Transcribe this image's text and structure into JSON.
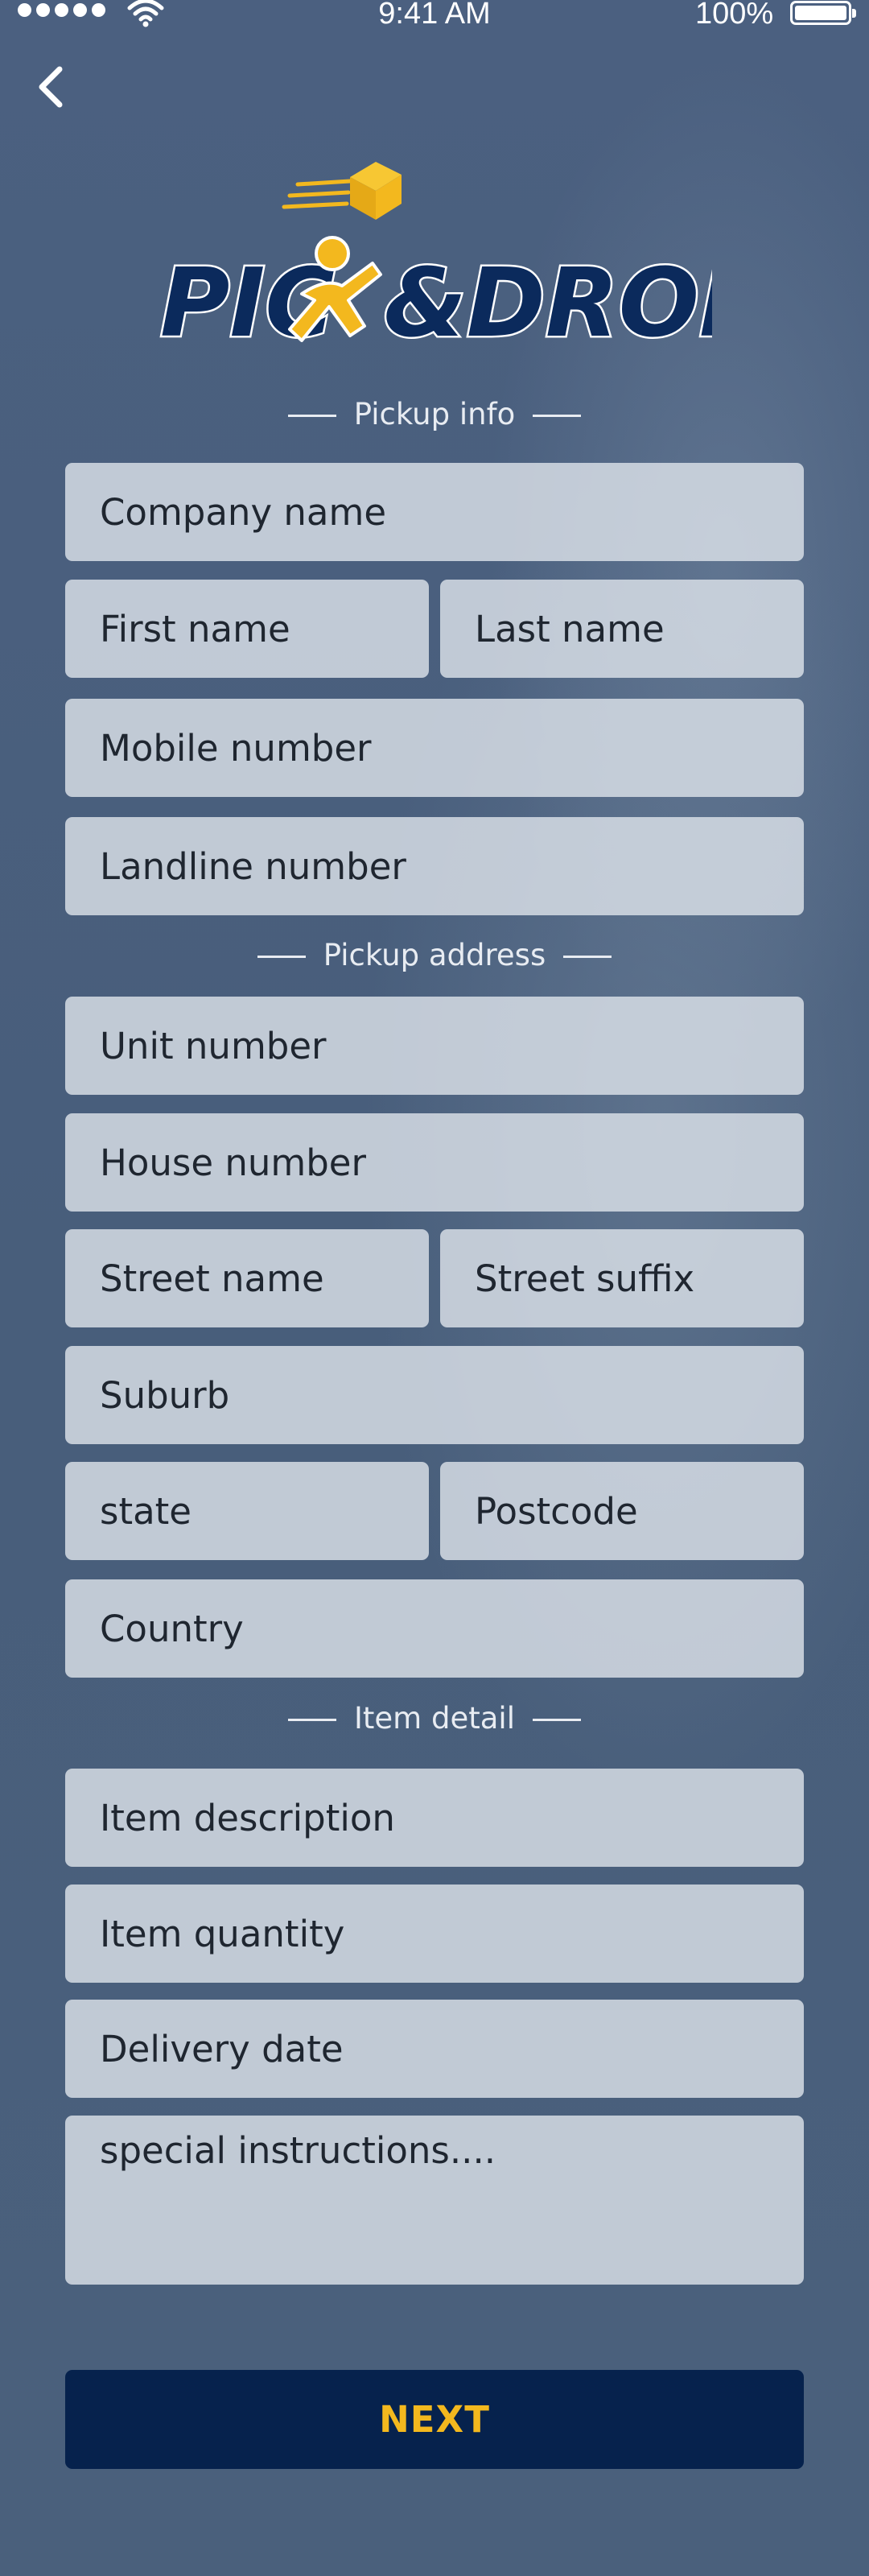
{
  "status_bar": {
    "time": "9:41 AM",
    "battery": "100%"
  },
  "logo": {
    "text_left": "PIC",
    "text_right": "&DROP",
    "brand_colors": {
      "navy": "#0b2a5c",
      "yellow": "#f3b81e",
      "white": "#ffffff"
    }
  },
  "sections": {
    "pickup_info": "Pickup info",
    "pickup_address": "Pickup address",
    "item_detail": "Item detail"
  },
  "fields": {
    "company_name": "Company name",
    "first_name": "First name",
    "last_name": "Last name",
    "mobile_number": "Mobile number",
    "landline_number": "Landline number",
    "unit_number": "Unit number",
    "house_number": "House number",
    "street_name": "Street name",
    "street_suffix": "Street suffix",
    "suburb": "Suburb",
    "state": "state",
    "postcode": "Postcode",
    "country": "Country",
    "item_description": "Item description",
    "item_quantity": "Item quantity",
    "delivery_date": "Delivery date",
    "special_instructions": "special instructions...."
  },
  "actions": {
    "next_label": "NEXT"
  },
  "colors": {
    "background": "#4a5f7a",
    "button": "#06224d",
    "button_text": "#f3b81e"
  }
}
